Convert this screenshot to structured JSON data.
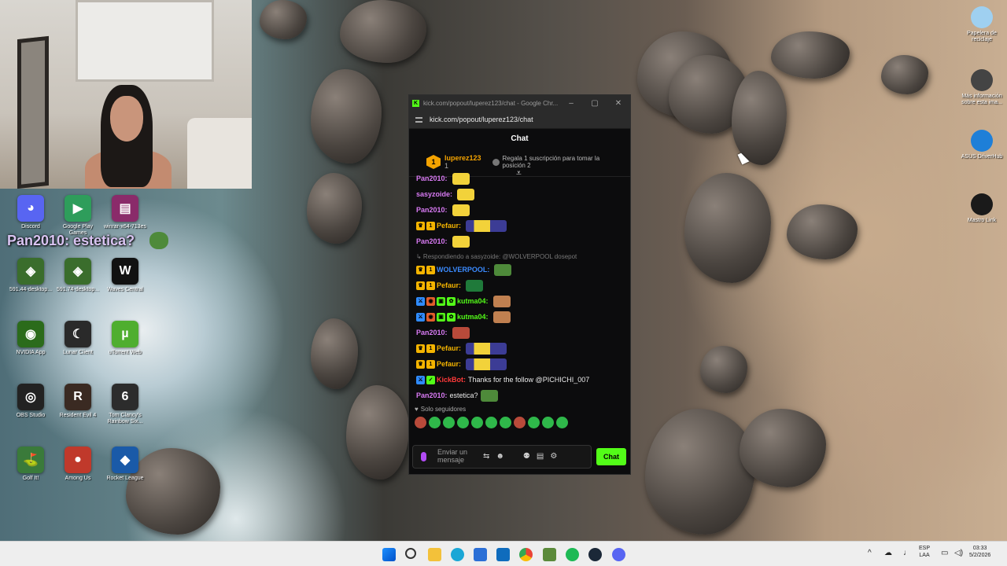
{
  "desktop": {
    "overlay_chat_user": "Pan2010",
    "overlay_chat_text": ": estetica?",
    "icons": [
      {
        "label": "Discord",
        "icon": "discord-icon",
        "color": "#5865f2",
        "glyph": "◕"
      },
      {
        "label": "Google Play Games",
        "icon": "google-play-games-icon",
        "color": "#2e9d5b",
        "glyph": "▶"
      },
      {
        "label": "winrar-x64-713es",
        "icon": "winrar-icon",
        "color": "#8a2b6a",
        "glyph": "▤"
      },
      {
        "label": "591.44-desktop...",
        "icon": "nvidia-driver-icon",
        "color": "#3a6d2c",
        "glyph": "◈"
      },
      {
        "label": "591.74-desktop...",
        "icon": "nvidia-driver-icon",
        "color": "#3a6d2c",
        "glyph": "◈"
      },
      {
        "label": "Waves Central",
        "icon": "waves-icon",
        "color": "#111111",
        "glyph": "W"
      },
      {
        "label": "NVIDIA App",
        "icon": "nvidia-icon",
        "color": "#2b6b1b",
        "glyph": "◉"
      },
      {
        "label": "Lunar Client",
        "icon": "lunar-client-icon",
        "color": "#2a2a2a",
        "glyph": "☾"
      },
      {
        "label": "uTorrent Web",
        "icon": "utorrent-icon",
        "color": "#4fae2f",
        "glyph": "µ"
      },
      {
        "label": "OBS Studio",
        "icon": "obs-icon",
        "color": "#222222",
        "glyph": "◎"
      },
      {
        "label": "Resident Evil 4",
        "icon": "resident-evil-icon",
        "color": "#3a2a22",
        "glyph": "R"
      },
      {
        "label": "Tom Clancy's Rainbow Six...",
        "icon": "rainbow-six-icon",
        "color": "#2c2c2c",
        "glyph": "6"
      },
      {
        "label": "Golf It!",
        "icon": "golf-it-icon",
        "color": "#3a7a3a",
        "glyph": "⛳"
      },
      {
        "label": "Among Us",
        "icon": "among-us-icon",
        "color": "#c0392b",
        "glyph": "●"
      },
      {
        "label": "Rocket League",
        "icon": "rocket-league-icon",
        "color": "#1a5aa8",
        "glyph": "◆"
      }
    ],
    "right_icons": [
      {
        "label": "Papelera de reciclaje",
        "icon": "recycle-bin-icon",
        "color": "#9fd0f0"
      },
      {
        "label": "Más información sobre esta ima...",
        "icon": "info-icon",
        "color": "#444444"
      },
      {
        "label": "ASUS DriverHub",
        "icon": "asus-driverhub-icon",
        "color": "#1e7fd8"
      },
      {
        "label": "Mastro Link",
        "icon": "mastro-link-icon",
        "color": "#1a1a1a"
      }
    ]
  },
  "browser": {
    "title": "kick.com/popout/luperez123/chat - Google Chr...",
    "url": "kick.com/popout/luperez123/chat",
    "minimize": "–",
    "maximize": "▢",
    "close": "✕"
  },
  "chat": {
    "header": "Chat",
    "pinned_user": "luperez123",
    "pinned_count": "1",
    "pinned_badge": "1",
    "pinned_text": "Regala 1 suscripción para tomar la posición 2",
    "reply_text": "↳ Respondiendo a sasyzoide: @WOLVERPOOL dosepot",
    "messages": [
      {
        "user": "Pan2010:",
        "color": "#d87af3",
        "badges": [],
        "text": "",
        "emote": "#f2d23a",
        "wide": false
      },
      {
        "user": "sasyzoide:",
        "color": "#d87af3",
        "badges": [],
        "text": "",
        "emote": "#f2d23a",
        "wide": false
      },
      {
        "user": "Pan2010:",
        "color": "#d87af3",
        "badges": [],
        "text": "",
        "emote": "#f2d23a",
        "wide": false
      },
      {
        "user": "Pefaur:",
        "color": "#f4b400",
        "badges": [
          "crown",
          "sub"
        ],
        "text": "",
        "emote": "#f2d23a",
        "wide": true
      },
      {
        "user": "Pan2010:",
        "color": "#d87af3",
        "badges": [],
        "text": "",
        "emote": "#f2d23a",
        "wide": false
      },
      {
        "user": "WOLVERPOOL:",
        "color": "#3b8bff",
        "badges": [
          "crown",
          "sub"
        ],
        "text": "",
        "emote": "#4e8a3a",
        "wide": false
      },
      {
        "user": "Pefaur:",
        "color": "#f4b400",
        "badges": [
          "crown",
          "sub"
        ],
        "text": "",
        "emote": "#1f7a3a",
        "wide": false
      },
      {
        "user": "kutma04:",
        "color": "#53fc18",
        "badges": [
          "mod",
          "ban",
          "gift",
          "bot"
        ],
        "text": "",
        "emote": "#c08050",
        "wide": false
      },
      {
        "user": "kutma04:",
        "color": "#53fc18",
        "badges": [
          "mod",
          "ban",
          "gift",
          "bot"
        ],
        "text": "",
        "emote": "#c08050",
        "wide": false
      },
      {
        "user": "Pan2010:",
        "color": "#d87af3",
        "badges": [],
        "text": "",
        "emote": "#b84a3a",
        "wide": false
      },
      {
        "user": "Pefaur:",
        "color": "#f4b400",
        "badges": [
          "crown",
          "sub"
        ],
        "text": "",
        "emote": "#f2d23a",
        "wide": true
      },
      {
        "user": "Pefaur:",
        "color": "#f4b400",
        "badges": [
          "crown",
          "sub"
        ],
        "text": "",
        "emote": "#f2d23a",
        "wide": true
      },
      {
        "user": "KickBot:",
        "color": "#ff3a3a",
        "badges": [
          "mod",
          "verified"
        ],
        "text": "Thanks for the follow @PICHICHI_007",
        "emote": "",
        "wide": false
      },
      {
        "user": "Pan2010:",
        "color": "#d87af3",
        "badges": [],
        "text": "estetica?",
        "emote": "#4e8a3a",
        "wide": false
      }
    ],
    "followers_only": "Solo seguidores",
    "input_placeholder": "Enviar un mensaje",
    "send_label": "Chat"
  },
  "taskbar": {
    "lang": "ESP",
    "lang2": "LAA",
    "time": "03:33",
    "date": "5/2/2026"
  },
  "colors": {
    "kick_green": "#53fc18",
    "chat_bg": "#0c0c0d"
  }
}
